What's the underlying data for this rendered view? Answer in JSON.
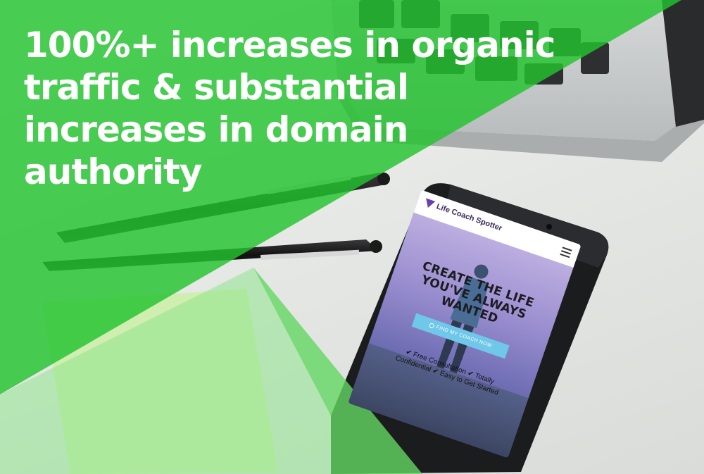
{
  "headline": "100%+ increases in organic traffic & substantial increases in domain authority",
  "phone": {
    "brand": "Life Coach Spotter",
    "hero_title": "CREATE THE LIFE YOU'VE ALWAYS WANTED",
    "cta_label": "FIND MY COACH NOW",
    "benefits_line1": "✔ Free Consultation ✔ Totally",
    "benefits_line2": "Confidential ✔ Easy to Get Started"
  },
  "colors": {
    "overlay_green": "#22c32e",
    "overlay_light_green": "#8fe58e",
    "sticky_note": "#cfeeb0",
    "phone_body": "#1b1c1e",
    "cta": "#6fc7ea"
  },
  "icons": [
    "brand-v-icon",
    "hamburger-menu-icon",
    "search-icon",
    "checkmark-icon"
  ]
}
